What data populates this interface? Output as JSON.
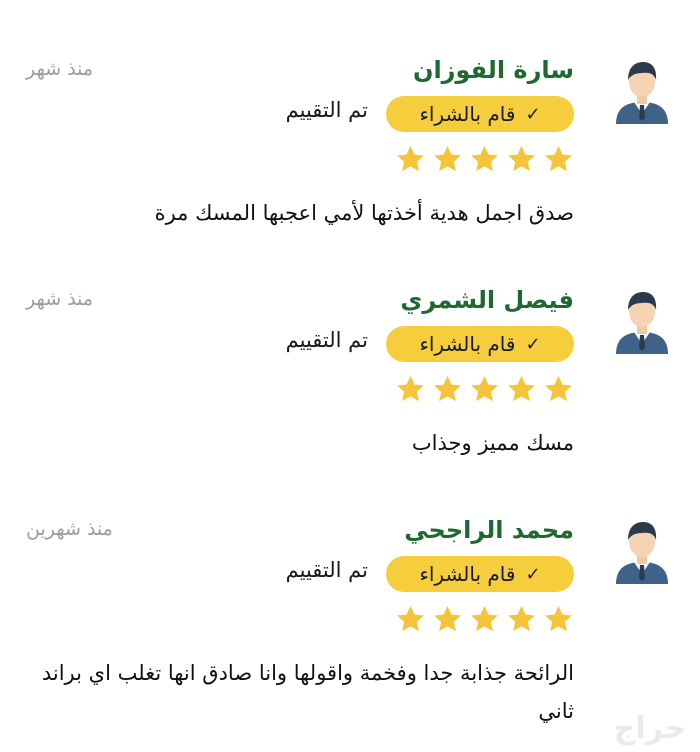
{
  "reviews": [
    {
      "name": "سارة الفوزان",
      "date": "منذ شهر",
      "badge": "قام بالشراء",
      "rated": "تم التقييم",
      "stars": 5,
      "comment": "صدق اجمل هدية أخذتها لأمي اعجبها المسك مرة"
    },
    {
      "name": "فيصل الشمري",
      "date": "منذ شهر",
      "badge": "قام بالشراء",
      "rated": "تم التقييم",
      "stars": 5,
      "comment": "مسك مميز وجذاب"
    },
    {
      "name": "محمد الراجحي",
      "date": "منذ شهرين",
      "badge": "قام بالشراء",
      "rated": "تم التقييم",
      "stars": 5,
      "comment": "الرائحة جذابة جدا وفخمة واقولها وانا صادق انها تغلب اي براند ثاني"
    }
  ],
  "colors": {
    "name": "#1e6a2e",
    "badge": "#f6cd3c",
    "star": "#f6c43a",
    "date": "#9c9c9c"
  },
  "icons": {
    "check": "✓",
    "avatar": "user-avatar-icon",
    "star": "star-icon"
  },
  "watermark": "حراج"
}
